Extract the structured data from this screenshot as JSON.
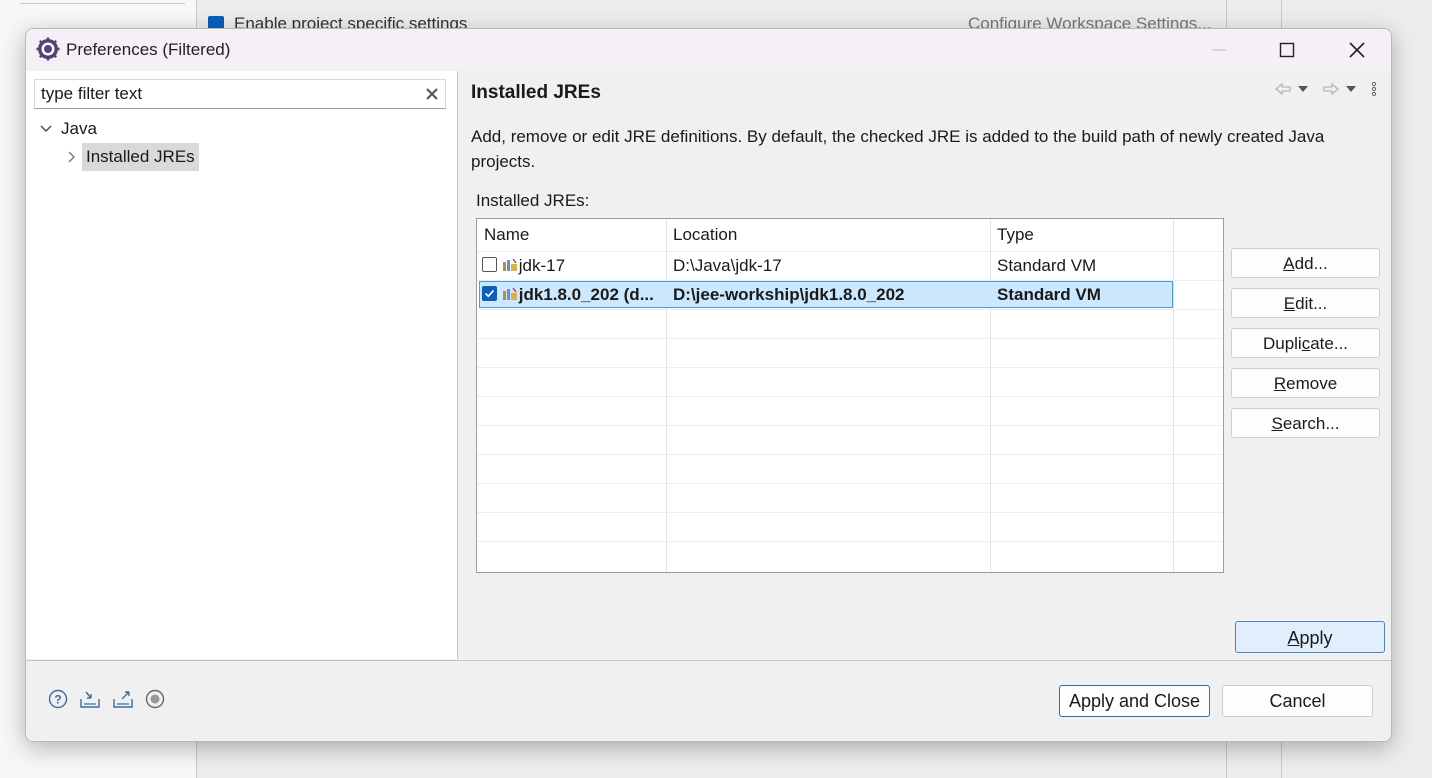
{
  "background": {
    "checkbox_text": "Enable project specific settings",
    "link_text": "Configure Workspace Settings..."
  },
  "window": {
    "title": "Preferences (Filtered)",
    "icon": "eclipse-gear-icon"
  },
  "left_pane": {
    "filter_placeholder": "type filter text",
    "tree": [
      {
        "label": "Java",
        "expanded": true
      },
      {
        "label": "Installed JREs",
        "selected": true
      }
    ]
  },
  "page": {
    "title": "Installed JREs",
    "description": "Add, remove or edit JRE definitions. By default, the checked JRE is added to the build path of newly created Java projects.",
    "table_label": "Installed JREs:",
    "columns": [
      "Name",
      "Location",
      "Type"
    ],
    "rows": [
      {
        "checked": false,
        "name": "jdk-17",
        "location": "D:\\Java\\jdk-17",
        "type": "Standard VM",
        "bold": false
      },
      {
        "checked": true,
        "name": "jdk1.8.0_202 (d...",
        "location": "D:\\jee-workship\\jdk1.8.0_202",
        "type": "Standard VM",
        "bold": true
      }
    ],
    "buttons": {
      "add": "Add...",
      "edit": "Edit...",
      "duplicate": "Duplicate...",
      "remove": "Remove",
      "search": "Search..."
    },
    "apply": "Apply"
  },
  "footer": {
    "icons": [
      "help-icon",
      "import-icon",
      "export-icon",
      "record-icon"
    ],
    "apply_close": "Apply and Close",
    "cancel": "Cancel"
  },
  "colors": {
    "selection": "#cce8ff",
    "accent": "#0a5fbf",
    "titlebar": "#f5eff6"
  }
}
